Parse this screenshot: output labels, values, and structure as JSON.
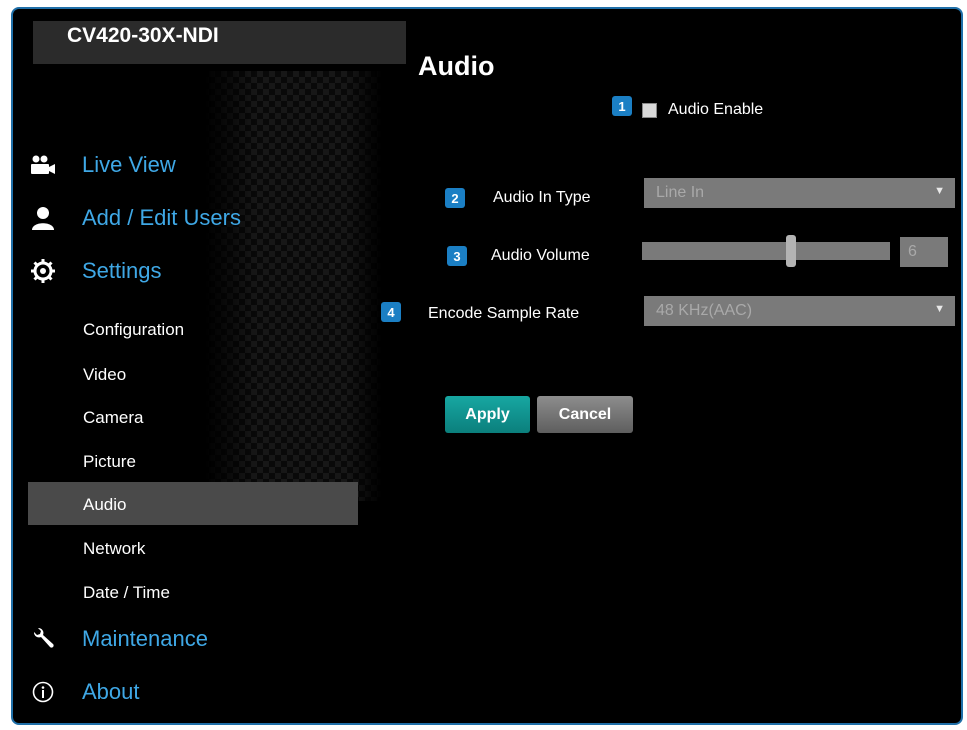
{
  "app": {
    "device_name": "CV420-30X-NDI"
  },
  "sidebar": {
    "live_view": "Live View",
    "add_edit_users": "Add / Edit Users",
    "settings": "Settings",
    "settings_items": [
      "Configuration",
      "Video",
      "Camera",
      "Picture",
      "Audio",
      "Network",
      "Date / Time"
    ],
    "active_item": "Audio",
    "maintenance": "Maintenance",
    "about": "About"
  },
  "main": {
    "title": "Audio",
    "audio_enable": {
      "badge": "1",
      "label": "Audio Enable",
      "checked": false
    },
    "audio_in_type": {
      "badge": "2",
      "label": "Audio In Type",
      "value": "Line In"
    },
    "audio_volume": {
      "badge": "3",
      "label": "Audio Volume",
      "value": "6",
      "level": 0.6
    },
    "encode_sample_rate": {
      "badge": "4",
      "label": "Encode Sample Rate",
      "value": "48 KHz(AAC)"
    },
    "apply_label": "Apply",
    "cancel_label": "Cancel"
  },
  "colors": {
    "accent": "#3fa8e6",
    "badge": "#1b7fc4",
    "apply": "#129896",
    "frame_border": "#1f6fa8"
  },
  "icons": [
    "video-camera-icon",
    "user-icon",
    "gear-icon",
    "wrench-icon",
    "info-icon",
    "dropdown-arrow-icon"
  ]
}
